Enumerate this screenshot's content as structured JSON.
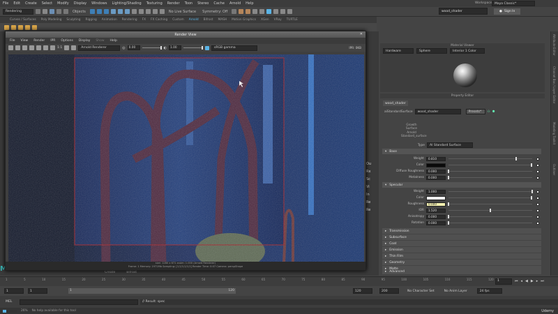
{
  "menubar": {
    "items": [
      "File",
      "Edit",
      "Create",
      "Select",
      "Modify",
      "Display",
      "Windows",
      "Lighting/Shading",
      "Texturing",
      "Render",
      "Toon",
      "Stereo",
      "Cache",
      "Arnold",
      "Help"
    ],
    "workspace_label": "Workspace :",
    "workspace_value": "Maya Classic*"
  },
  "toolbar": {
    "mode": "Rendering",
    "objects": "Objects",
    "live_surface": "No Live Surface",
    "symmetry": "Symmetry: Off",
    "name_field": "wood_shader",
    "sign_in": "Sign In"
  },
  "shelf": {
    "tabs": [
      "Curves / Surfaces",
      "Poly Modeling",
      "Sculpting",
      "Rigging",
      "Animation",
      "Rendering",
      "FX",
      "FX Caching",
      "Custom",
      "Arnold",
      "Bifrost",
      "MASH",
      "Motion Graphics",
      "XGen",
      "VRay",
      "TURTLE"
    ],
    "active_tab": "Arnold"
  },
  "render_view": {
    "title": "Render View",
    "menu": [
      "File",
      "View",
      "Render",
      "IPR",
      "Options",
      "Display",
      "Show",
      "Help"
    ],
    "ratio": "1:1",
    "renderer": "Arnold Renderer",
    "exposure": "0.00",
    "gamma": "1.00",
    "colorspace": "sRGB gamma",
    "ipr_label": "IPR: 0KB",
    "status_line1": "size: 1280 x 671 zoom: 1.000    (Arnold Renderer)",
    "status_line2": "Frame: 1    Memory: 1971Mb    Sampling: [1/1/1/1/1/1]    Render Time: 0:07    Camera: perspShape"
  },
  "material_viewer": {
    "title": "Material Viewer",
    "renderer": "Hardware",
    "shape": "Sphere",
    "light": "Interior 1 Color"
  },
  "property_editor": {
    "title": "Property Editor",
    "tab": "wood_shader",
    "node_type": "aiStandardSurface",
    "node_name": "wood_shader",
    "presets": "Presets*",
    "hierarchy": [
      "Growth",
      "Surface",
      "Arnold",
      "Standard_surface"
    ],
    "type_label": "Type",
    "type_value": "AI Standard Surface",
    "base": {
      "label": "Base",
      "weight": {
        "label": "Weight",
        "value": "0.810",
        "level": 0.81
      },
      "color": {
        "label": "Color",
        "swatch": "#0a0a0a"
      },
      "diffuse_roughness": {
        "label": "Diffuse Roughness",
        "value": "0.000",
        "level": 0
      },
      "metalness": {
        "label": "Metalness",
        "value": "0.000",
        "level": 0
      }
    },
    "specular": {
      "label": "Specular",
      "weight": {
        "label": "Weight",
        "value": "1.000",
        "level": 1
      },
      "color": {
        "label": "Color",
        "swatch": "#f2f2f2"
      },
      "roughness": {
        "label": "Roughness",
        "value": "0.000",
        "level": 0
      },
      "ior": {
        "label": "IOR",
        "value": "1.520",
        "level": 0.5
      },
      "anisotropy": {
        "label": "Anisotropy",
        "value": "0.000",
        "level": 0
      },
      "rotation": {
        "label": "Rotation",
        "value": "0.000",
        "level": 0
      }
    },
    "sections": [
      "Transmission",
      "Subsurface",
      "Coat",
      "Emission",
      "Thin Film",
      "Geometry",
      "Matte",
      "Advanced"
    ]
  },
  "side_strip": [
    "Attribute Editor",
    "Channel Box / Layer Editor",
    "Modeling Toolkit",
    "Outliner"
  ],
  "viewport_bg": {
    "tabs": [
      "Create",
      "Bifrost"
    ],
    "labels": [
      "Ou",
      "Rx",
      "Sc",
      "Vi",
      "In",
      "Re",
      "Re"
    ]
  },
  "timeline": {
    "ticks": [
      "1",
      "5",
      "10",
      "15",
      "20",
      "25",
      "30",
      "35",
      "40",
      "45",
      "50",
      "55",
      "60",
      "65",
      "70",
      "75",
      "80",
      "85",
      "90",
      "95",
      "100",
      "105",
      "110",
      "115",
      "120"
    ],
    "current": "1"
  },
  "range": {
    "start": "1",
    "inner_start": "1",
    "inner_end": "120",
    "end": "120",
    "anim_end": "200",
    "char_set": "No Character Set",
    "anim_layer": "No Anim Layer",
    "fps": "24 fps"
  },
  "mel": {
    "label": "MEL",
    "result": "// Result: spec"
  },
  "help": {
    "text": "No help available for this tool",
    "brand": "Udemy",
    "progress": "26%"
  },
  "colors": {
    "accent": "#5ab4e6",
    "render_crop": "#a2222a"
  }
}
